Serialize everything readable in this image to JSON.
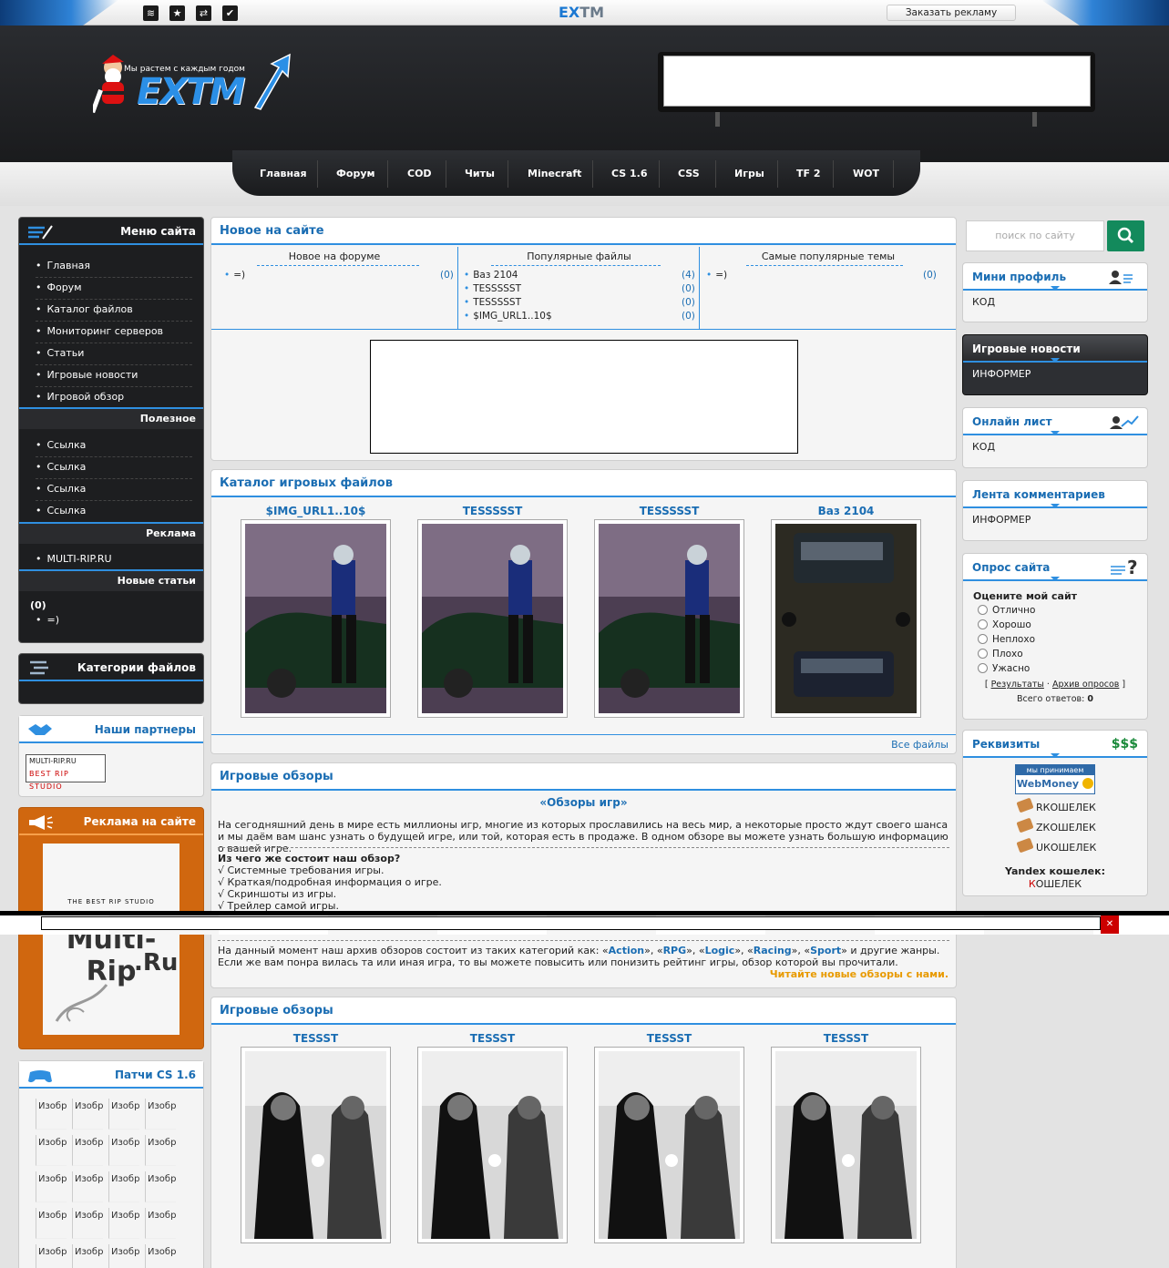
{
  "top": {
    "logo_prefix": "EX",
    "logo_suffix": "TM",
    "ad_button": "Заказать рекламу"
  },
  "header": {
    "slogan": "Мы растем с каждым годом",
    "logo_word": "EXTM"
  },
  "nav": [
    "Главная",
    "Форум",
    "COD",
    "Читы",
    "Minecraft",
    "CS 1.6",
    "CSS",
    "Игры",
    "TF 2",
    "WOT"
  ],
  "left": {
    "menu_title": "Меню сайта",
    "menu": [
      "Главная",
      "Форум",
      "Каталог файлов",
      "Мониторинг серверов",
      "Статьи",
      "Игровые новости",
      "Игровой обзор"
    ],
    "useful_title": "Полезное",
    "useful": [
      "Ссылка",
      "Ссылка",
      "Ссылка",
      "Ссылка"
    ],
    "ads_title": "Реклама",
    "ads": [
      "MULTI-RIP.RU"
    ],
    "articles_title": "Новые статьи",
    "articles_count": "(0)",
    "articles_item": "=)",
    "categories_title": "Категории файлов",
    "partners_title": "Наши партнеры",
    "partner_banner_line1": "MULTI-RIP.RU",
    "partner_banner_line2": "BEST RIP STUDIO",
    "site_ads_title": "Реклама на сайте",
    "site_ads_line1": "THE BEST RIP STUDIO",
    "site_ads_line2": "Multi-Rip",
    "site_ads_line3": ".Ru",
    "patches_title": "Патчи CS 1.6",
    "patch_cell": "Изобр"
  },
  "center": {
    "new_title": "Новое на сайте",
    "col1_title": "Новое на форуме",
    "col1_rows": [
      {
        "t": "=)",
        "c": "(0)"
      }
    ],
    "col2_title": "Популярные файлы",
    "col2_rows": [
      {
        "t": "Ваз 2104",
        "c": "(4)"
      },
      {
        "t": "TESSSSST",
        "c": "(0)"
      },
      {
        "t": "TESSSSST",
        "c": "(0)"
      },
      {
        "t": "$IMG_URL1..10$",
        "c": "(0)"
      }
    ],
    "col3_title": "Самые популярные темы",
    "col3_rows": [
      {
        "t": "=)",
        "c": "(0)"
      }
    ],
    "catalog_title": "Каталог игровых файлов",
    "catalog_items": [
      "$IMG_URL1..10$",
      "TESSSSST",
      "TESSSSST",
      "Ваз 2104"
    ],
    "all_files": "Все файлы",
    "reviews_title": "Игровые обзоры",
    "reviews_heading": "«Обзоры игр»",
    "reviews_p1": "На сегодняшний день в мире есть миллионы игр, многие из которых прославились на весь мир, а некоторые просто ждут своего шанса и мы даём вам шанс узнать о будущей игре, или той, которая есть в продаже. В одном обзоре вы можете узнать большую информацию о вашей игре.",
    "reviews_q": "Из чего же состоит наш обзор?",
    "reviews_list": [
      "√ Системные требования игры.",
      "√ Краткая/подробная информация о игре.",
      "√ Скриншоты из игры.",
      "√ Трейлер самой игры."
    ],
    "reviews_p2_a": "На данный момент наш архив обзоров состоит из таких категорий как: «",
    "cat_action": "Action",
    "cat_rpg": "RPG",
    "cat_logic": "Logic",
    "cat_racing": "Racing",
    "cat_sport": "Sport",
    "reviews_p2_b": "» и другие жанры. Если же вам понра вилась та или иная игра, то вы можете повысить или понизить рейтинг игры, обзор которой вы прочитали.",
    "reviews_link": "Читайте новые обзоры с нами.",
    "reviews2_title": "Игровые обзоры",
    "reviews2_items": [
      "TESSST",
      "TESSST",
      "TESSST",
      "TESSST"
    ]
  },
  "right": {
    "search_placeholder": "поиск по сайту",
    "mini_title": "Мини профиль",
    "mini_body": "КОД",
    "news_title": "Игровые новости",
    "news_body": "ИНФОРМЕР",
    "online_title": "Онлайн лист",
    "online_body": "КОД",
    "comments_title": "Лента комментариев",
    "comments_body": "ИНФОРМЕР",
    "poll_title": "Опрос сайта",
    "poll_q": "Оцените мой сайт",
    "poll_opts": [
      "Отлично",
      "Хорошо",
      "Неплохо",
      "Плохо",
      "Ужасно"
    ],
    "poll_results": "Результаты",
    "poll_archive": "Архив опросов",
    "poll_total_label": "Всего ответов:",
    "poll_total": "0",
    "req_title": "Реквизиты",
    "wm_top": "мы принимаем",
    "wm_name": "WebMoney",
    "wallets": [
      "RКОШЕЛЕК",
      "ZКОШЕЛЕК",
      "UКОШЕЛЕК"
    ],
    "yandex_label": "Yandex кошелек:",
    "yandex_k": "К",
    "yandex_rest": "ОШЕЛЕК"
  },
  "colors": {
    "accent": "#2f8fe0",
    "link": "#1a6db3",
    "dark": "#1d1e20",
    "orange": "#d0670f"
  }
}
